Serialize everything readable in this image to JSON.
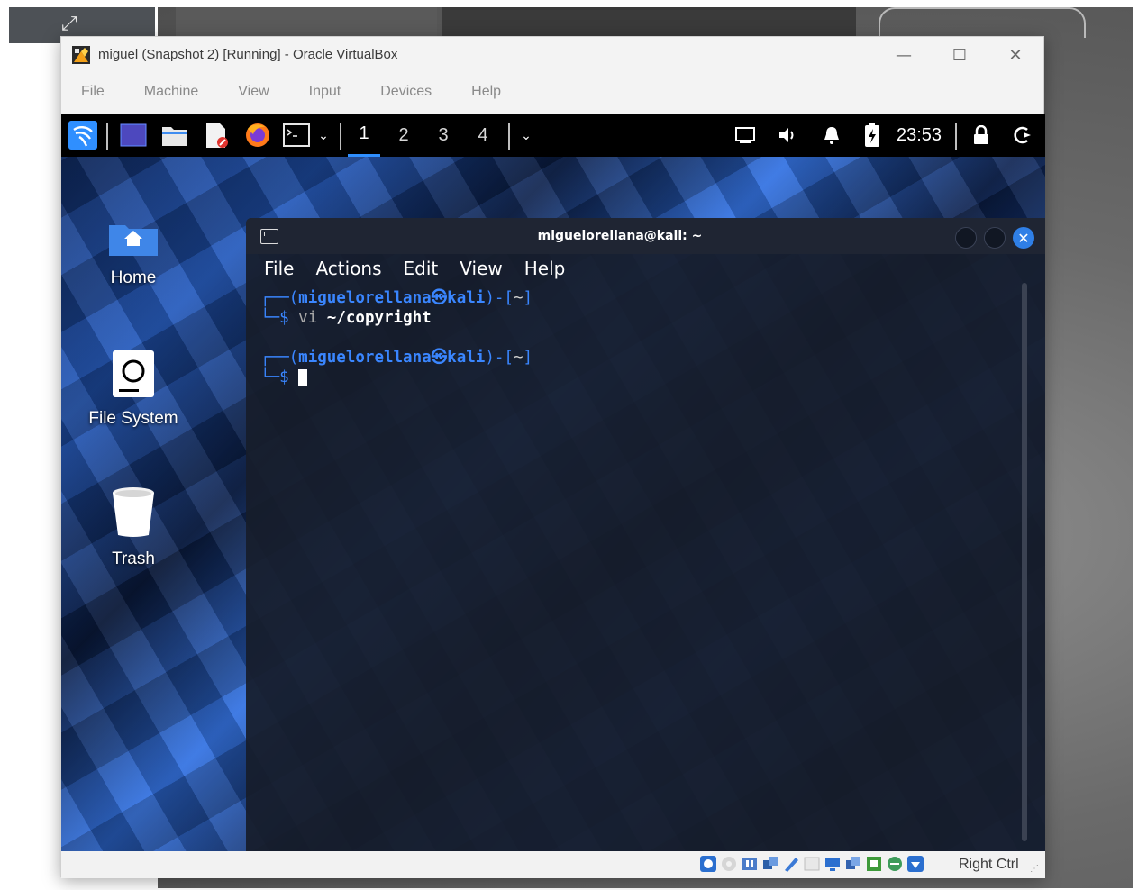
{
  "window": {
    "title": "miguel (Snapshot 2) [Running] - Oracle VirtualBox",
    "minimize_glyph": "—",
    "maximize_glyph": "☐",
    "close_glyph": "✕"
  },
  "vbox_menu": [
    {
      "label": "File"
    },
    {
      "label": "Machine"
    },
    {
      "label": "View"
    },
    {
      "label": "Input"
    },
    {
      "label": "Devices"
    },
    {
      "label": "Help"
    }
  ],
  "kali_panel": {
    "workspaces": [
      "1",
      "2",
      "3",
      "4"
    ],
    "active_workspace": "1",
    "clock": "23:53",
    "accent": "#2f8fff"
  },
  "desktop_icons": [
    {
      "label": "Home",
      "icon": "home-folder-icon"
    },
    {
      "label": "File System",
      "icon": "drive-icon"
    },
    {
      "label": "Trash",
      "icon": "trash-icon"
    }
  ],
  "terminal": {
    "title": "miguelorellana@kali: ~",
    "menu": [
      {
        "label": "File"
      },
      {
        "label": "Actions"
      },
      {
        "label": "Edit"
      },
      {
        "label": "View"
      },
      {
        "label": "Help"
      }
    ],
    "prompt_user": "miguelorellana",
    "prompt_at": "㉿",
    "prompt_host": "kali",
    "prompt_dir": "~",
    "line1_cmd": "vi",
    "line1_arg": "~/copyright",
    "dollar": "$"
  },
  "status_bar": {
    "host_key": "Right Ctrl"
  }
}
